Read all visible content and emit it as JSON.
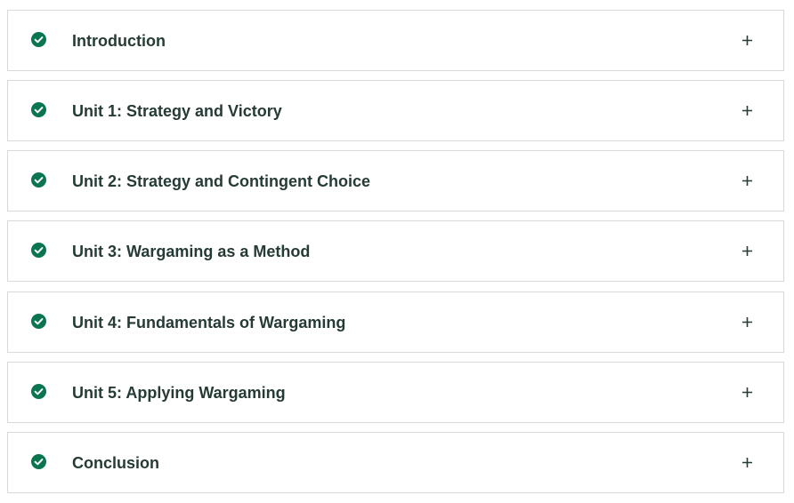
{
  "accordion": {
    "check_color": "#0b7550",
    "expand_icon": "plus-icon",
    "status_icon": "check-circle-icon",
    "items": [
      {
        "label": "Introduction"
      },
      {
        "label": "Unit 1: Strategy and Victory"
      },
      {
        "label": "Unit 2: Strategy and Contingent Choice"
      },
      {
        "label": "Unit 3: Wargaming as a Method"
      },
      {
        "label": "Unit 4: Fundamentals of Wargaming"
      },
      {
        "label": "Unit 5: Applying Wargaming"
      },
      {
        "label": "Conclusion"
      }
    ]
  }
}
